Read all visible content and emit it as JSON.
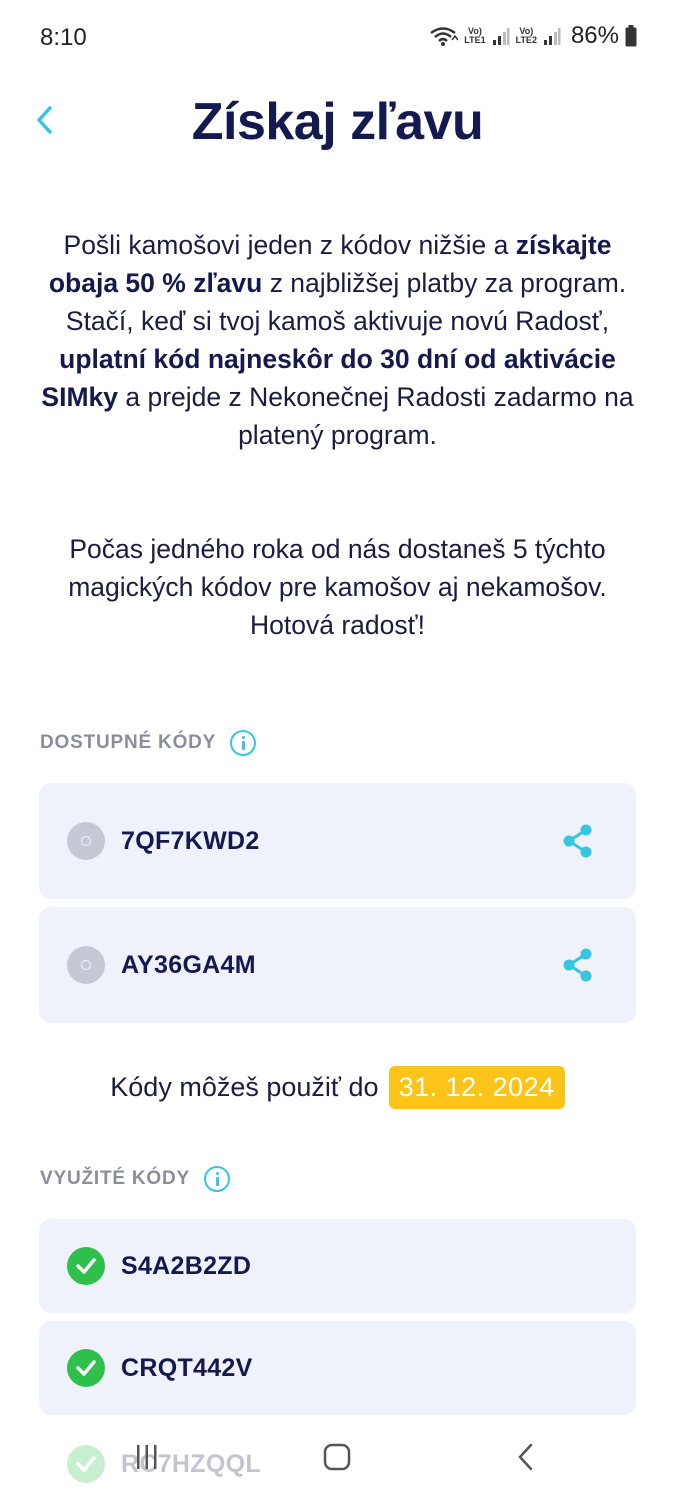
{
  "status_bar": {
    "time": "8:10",
    "sim1_label_top": "Vo)",
    "sim1_label_bottom": "LTE1",
    "sim2_label_top": "Vo)",
    "sim2_label_bottom": "LTE2",
    "battery": "86%"
  },
  "header": {
    "back_icon": "chevron-left-icon",
    "title": "Získaj zľavu"
  },
  "description": {
    "p1_a": "Pošli kamošovi jeden z kódov nižšie a ",
    "p1_b": "získajte obaja 50 % zľavu",
    "p1_c": " z najbližšej platby za program. Stačí, keď si tvoj kamoš aktivuje novú Radosť, ",
    "p1_d": "uplatní kód najneskôr do 30 dní od aktivácie SIMky",
    "p1_e": " a prejde z Nekonečnej Radosti zadarmo na platený program.",
    "p2": "Počas jedného roka od nás dostaneš 5 týchto magických kódov pre kamošov aj nekamošov. Hotová radosť!"
  },
  "available_codes": {
    "label": "DOSTUPNÉ KÓDY",
    "items": [
      {
        "code": "7QF7KWD2"
      },
      {
        "code": "AY36GA4M"
      }
    ]
  },
  "expiry": {
    "text": "Kódy môžeš použiť do",
    "date": "31. 12. 2024"
  },
  "used_codes": {
    "label": "VYUŽITÉ KÓDY",
    "items": [
      {
        "code": "S4A2B2ZD"
      },
      {
        "code": "CRQT442V"
      },
      {
        "code": "RC7HZQQL"
      }
    ]
  },
  "colors": {
    "accent": "#36c6e0",
    "title": "#141a4e",
    "card_bg": "#f0f2fb",
    "success": "#2ec04a",
    "highlight": "#fcc419"
  },
  "nav_bar": {
    "recents_icon": "recents-icon",
    "home_icon": "home-icon",
    "back_icon": "back-icon"
  }
}
